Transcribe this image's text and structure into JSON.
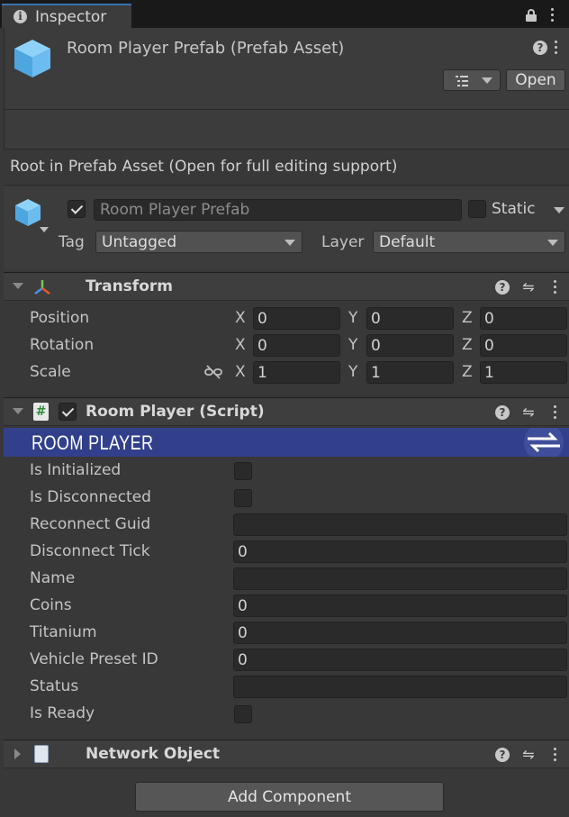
{
  "tab": {
    "title": "Inspector"
  },
  "prefab_header": {
    "title": "Room Player Prefab (Prefab Asset)",
    "open_label": "Open",
    "notice": "Root in Prefab Asset (Open for full editing support)"
  },
  "gameobject": {
    "name": "Room Player Prefab",
    "static_label": "Static",
    "tag_label": "Tag",
    "tag_value": "Untagged",
    "layer_label": "Layer",
    "layer_value": "Default"
  },
  "transform": {
    "title": "Transform",
    "rows": [
      {
        "label": "Position",
        "x": "0",
        "y": "0",
        "z": "0"
      },
      {
        "label": "Rotation",
        "x": "0",
        "y": "0",
        "z": "0"
      },
      {
        "label": "Scale",
        "x": "1",
        "y": "1",
        "z": "1"
      }
    ],
    "axis_x": "X",
    "axis_y": "Y",
    "axis_z": "Z"
  },
  "script_component": {
    "title": "Room Player (Script)",
    "banner": "ROOM PLAYER",
    "banner_color": "#32408c",
    "fields": {
      "is_initialized": "Is Initialized",
      "is_disconnected": "Is Disconnected",
      "reconnect_guid": "Reconnect Guid",
      "reconnect_guid_value": "",
      "disconnect_tick": "Disconnect Tick",
      "disconnect_tick_value": "0",
      "name": "Name",
      "name_value": "",
      "coins": "Coins",
      "coins_value": "0",
      "titanium": "Titanium",
      "titanium_value": "0",
      "vehicle_preset_id": "Vehicle Preset ID",
      "vehicle_preset_id_value": "0",
      "status": "Status",
      "status_value": "",
      "is_ready": "Is Ready"
    }
  },
  "network_object": {
    "title": "Network Object"
  },
  "add_component_label": "Add Component"
}
